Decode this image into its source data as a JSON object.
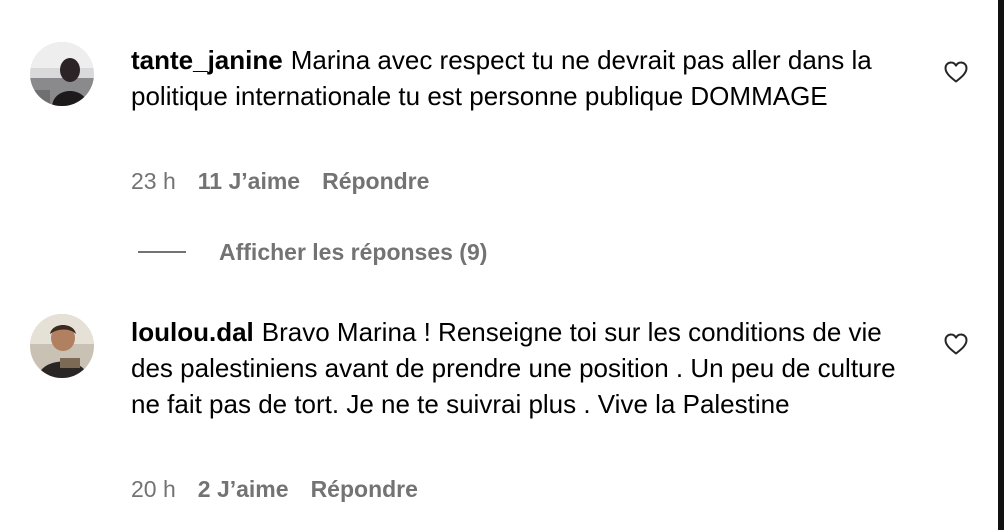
{
  "comments": [
    {
      "username": "tante_janine",
      "text": "Marina avec respect tu ne devrait pas aller dans la politique internationale tu est personne publique DOMMAGE",
      "time": "23 h",
      "likes": "11 J’aime",
      "reply_label": "Répondre",
      "like_icon": "heart-outline-icon"
    },
    {
      "username": "loulou.dal",
      "text": "Bravo Marina ! Renseigne toi sur les conditions de vie des palestiniens avant de prendre une position . Un peu de culture ne fait pas de tort. Je ne te suivrai plus . Vive la Palestine",
      "time": "20 h",
      "likes": "2 J’aime",
      "reply_label": "Répondre",
      "like_icon": "heart-outline-icon"
    }
  ],
  "replies_toggle": {
    "label": "Afficher les réponses (9)"
  },
  "colors": {
    "text": "#000000",
    "secondary": "#737373",
    "background": "#ffffff"
  }
}
